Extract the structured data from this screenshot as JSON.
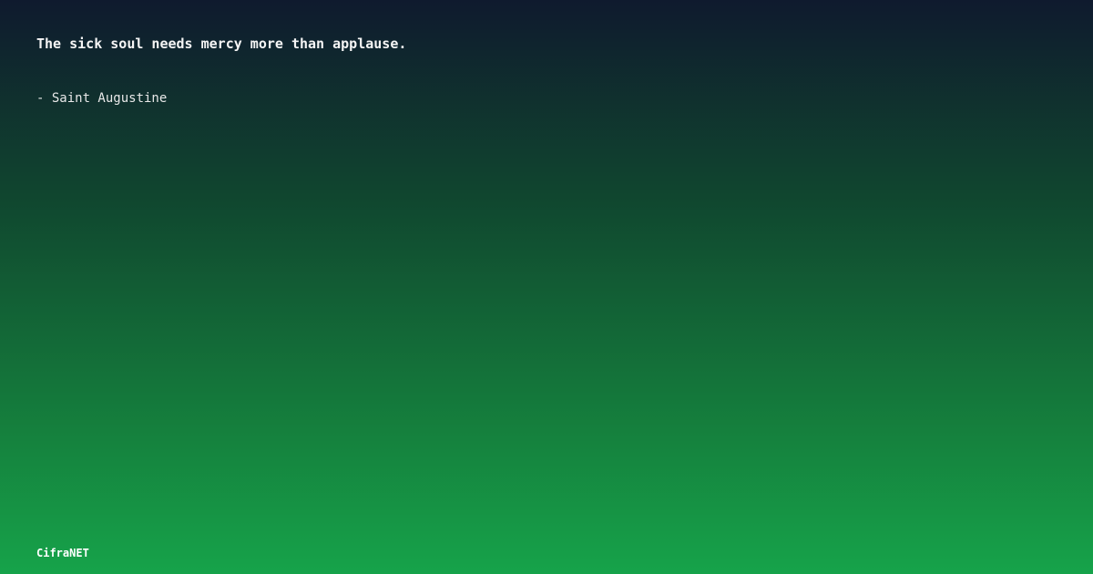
{
  "quote": {
    "text": "The sick soul needs mercy more than applause.",
    "author": "- Saint Augustine"
  },
  "brand": {
    "name": "CifraNET"
  },
  "colors": {
    "gradient_top": "#0f1a2e",
    "gradient_bottom": "#16a34a",
    "text": "#f5f5f5"
  }
}
